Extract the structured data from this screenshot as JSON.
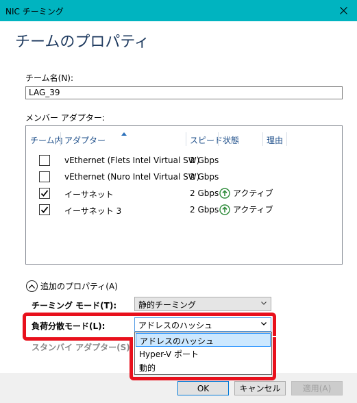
{
  "window": {
    "title": "NIC チーミング"
  },
  "heading": "チームのプロパティ",
  "team_name": {
    "label": "チーム名(N):",
    "value": "LAG_39"
  },
  "members": {
    "label": "メンバー アダプター:",
    "columns": [
      "チーム内",
      "アダプター",
      "スピード",
      "状態",
      "理由"
    ],
    "rows": [
      {
        "checked": false,
        "adapter": "vEthernet (Flets Intel Virtual SW)",
        "speed": "2 Gbps",
        "status": ""
      },
      {
        "checked": false,
        "adapter": "vEthernet (Nuro Intel Virtual SW)",
        "speed": "2 Gbps",
        "status": ""
      },
      {
        "checked": true,
        "adapter": "イーサネット",
        "speed": "2 Gbps",
        "status": "アクティブ"
      },
      {
        "checked": true,
        "adapter": "イーサネット 3",
        "speed": "2 Gbps",
        "status": "アクティブ"
      }
    ]
  },
  "additional": {
    "label": "追加のプロパティ(A)",
    "teaming_mode": {
      "label": "チーミング モード(T):",
      "value": "静的チーミング"
    },
    "load_balancing": {
      "label": "負荷分散モード(L):",
      "value": "アドレスのハッシュ"
    },
    "standby": {
      "label": "スタンバイ アダプター(S):"
    },
    "dropdown_options": [
      "アドレスのハッシュ",
      "Hyper-V ポート",
      "動的"
    ]
  },
  "buttons": {
    "ok": "OK",
    "cancel": "キャンセル",
    "apply": "適用(A)"
  },
  "colors": {
    "titlebar": "#00b4c0",
    "highlight": "#e8101c",
    "active": "#2e8b3a"
  }
}
